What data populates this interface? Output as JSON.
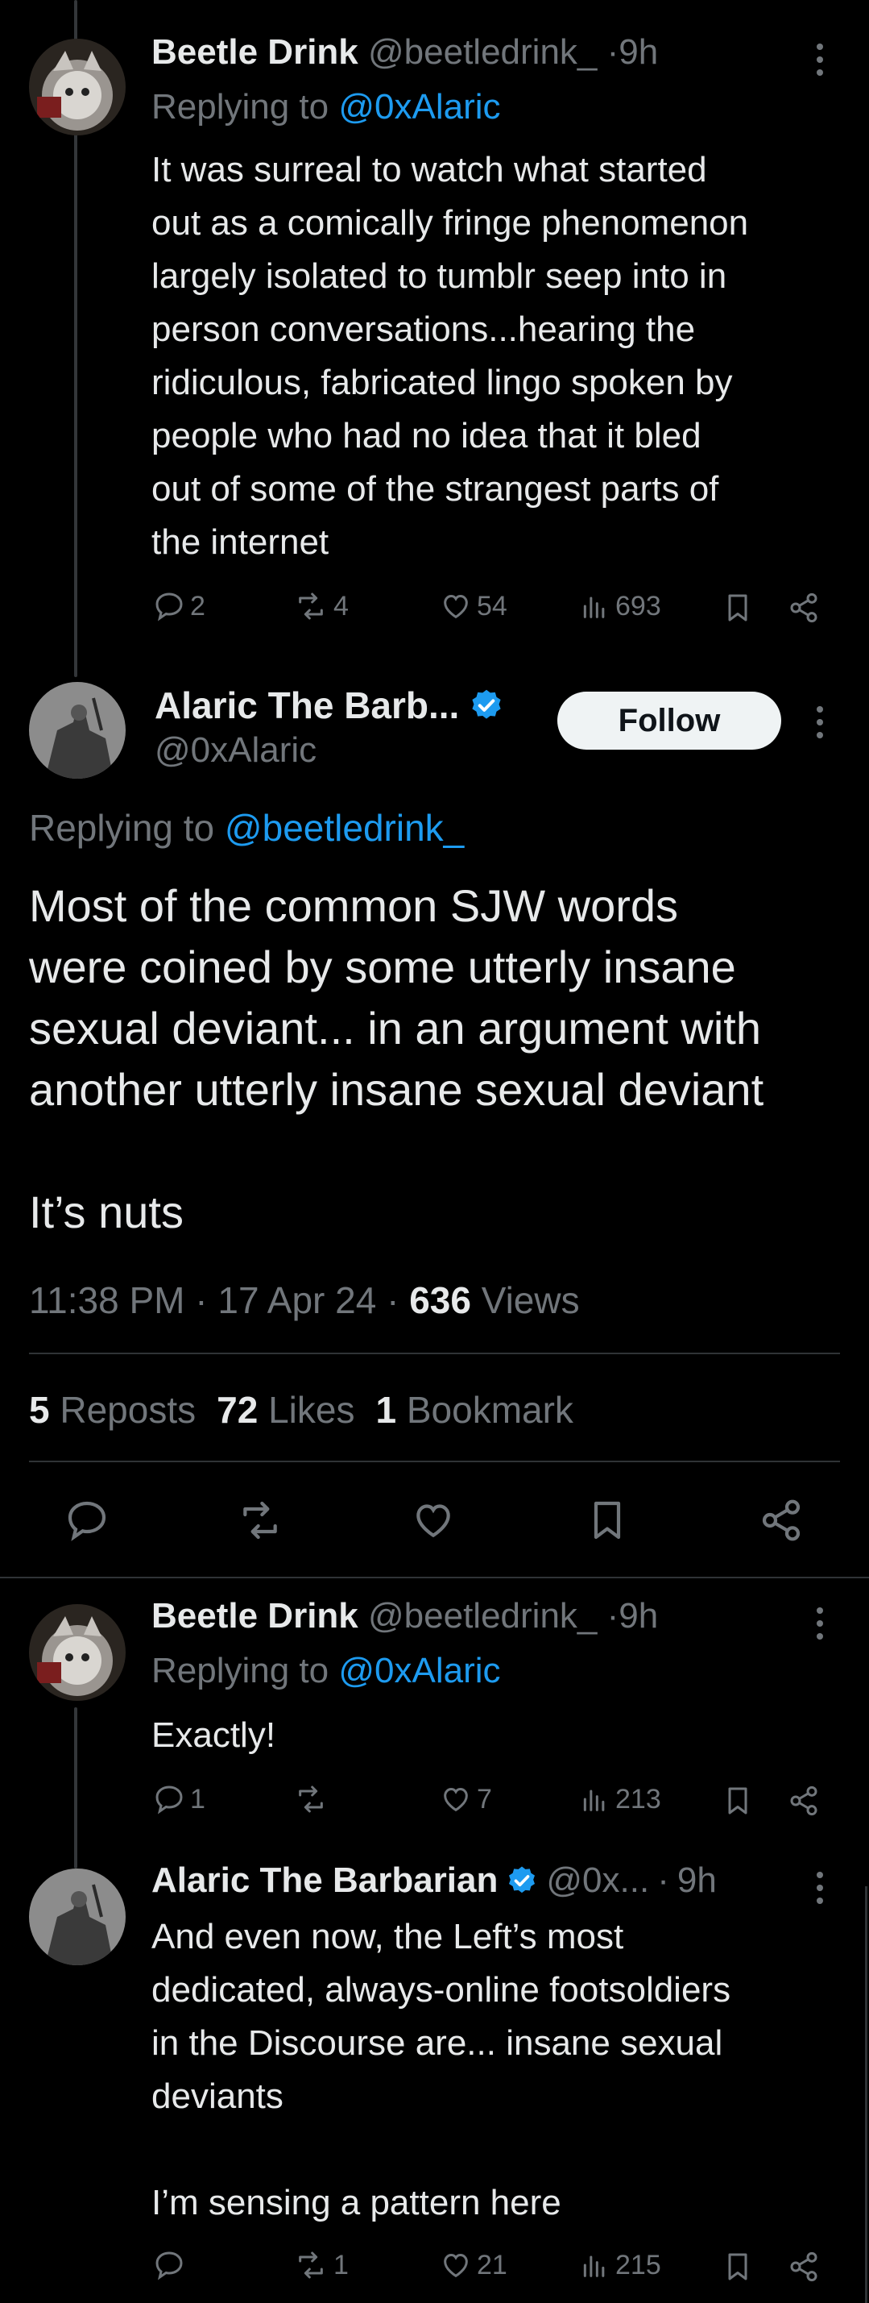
{
  "tweets": [
    {
      "author": "Beetle Drink",
      "handle": "@beetledrink_",
      "time_sep": "·",
      "time": "9h",
      "replying_prefix": "Replying to",
      "replying_to": "@0xAlaric",
      "lines": [
        "It was surreal to watch what started",
        "out as a comically fringe phenomenon",
        "largely isolated to tumblr seep into in",
        "person conversations...hearing the",
        "ridiculous, fabricated lingo spoken by",
        "people who had no idea that it bled",
        "out of some of the strangest parts of",
        "the internet"
      ],
      "replies": "2",
      "reposts": "4",
      "likes": "54",
      "views": "693"
    },
    {
      "author": "Beetle Drink",
      "handle": "@beetledrink_",
      "time_sep": "·",
      "time": "9h",
      "replying_prefix": "Replying to",
      "replying_to": "@0xAlaric",
      "lines": [
        "Exactly!"
      ],
      "replies": "1",
      "reposts": "",
      "likes": "7",
      "views": "213"
    },
    {
      "author": "Alaric The Barbarian",
      "handle": "@0x...",
      "time_sep": "·",
      "time": "9h",
      "lines": [
        "And even now, the Left’s most",
        "dedicated, always-online footsoldiers",
        "in the Discourse are... insane sexual",
        "deviants",
        "",
        "I’m sensing a pattern here"
      ],
      "replies": "",
      "reposts": "1",
      "likes": "21",
      "views": "215"
    }
  ],
  "main": {
    "author": "Alaric The Barb...",
    "handle": "@0xAlaric",
    "follow_label": "Follow",
    "replying_prefix": "Replying to",
    "replying_to": "@beetledrink_",
    "lines": [
      "Most of the common SJW words",
      "were coined by some utterly insane",
      "sexual deviant... in an argument with",
      "another utterly insane sexual deviant",
      "",
      "It’s nuts"
    ],
    "time": "11:38 PM",
    "sep": "·",
    "date": "17 Apr 24",
    "views_count": "636",
    "views_label": "Views",
    "reposts_count": "5",
    "reposts_label": "Reposts",
    "likes_count": "72",
    "likes_label": "Likes",
    "bookmarks_count": "1",
    "bookmarks_label": "Bookmark"
  },
  "colors": {
    "background": "#000000",
    "text": "#e7e9ea",
    "muted": "#71767b",
    "link": "#1d9bf0",
    "verified": "#1d9bf0"
  },
  "icons": [
    "reply-icon",
    "repost-icon",
    "like-icon",
    "views-icon",
    "bookmark-icon",
    "share-icon",
    "more-icon",
    "verified-badge-icon"
  ]
}
